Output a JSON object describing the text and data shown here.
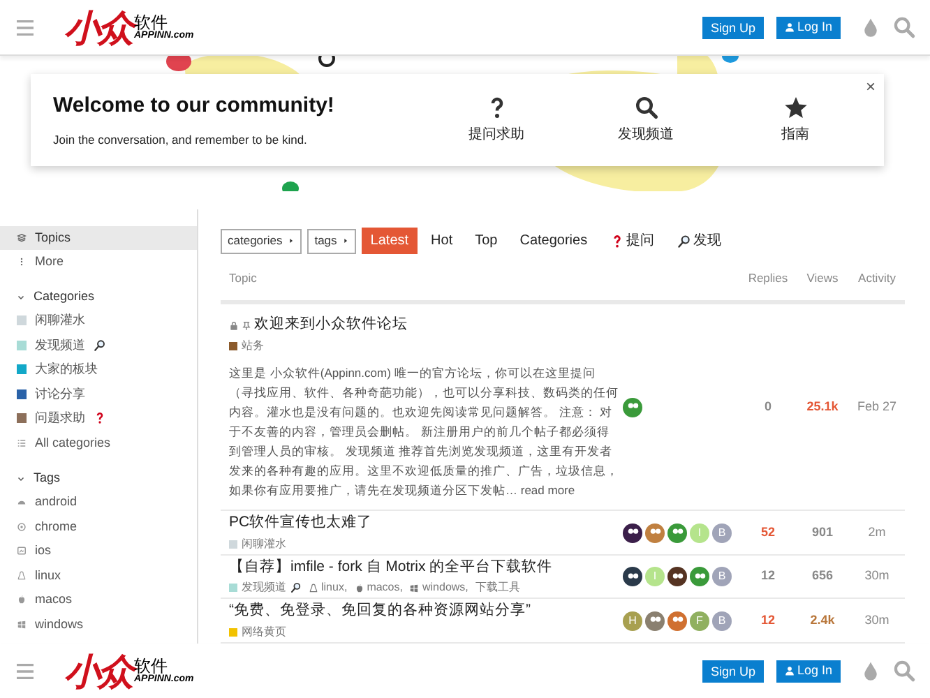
{
  "headers": [
    {
      "logo_mark": "小众",
      "logo_cn": "软件",
      "logo_en": "APPINN.com",
      "signup": "Sign Up",
      "login": "Log In"
    },
    {
      "logo_mark": "小众",
      "logo_cn": "软件",
      "logo_en": "APPINN.com",
      "signup": "Sign Up",
      "login": "Log In"
    }
  ],
  "welcome": {
    "title": "Welcome to our community!",
    "subtitle": "Join the conversation, and remember to be kind.",
    "links": [
      {
        "label": "提问求助"
      },
      {
        "label": "发现频道"
      },
      {
        "label": "指南"
      }
    ],
    "close": "×"
  },
  "sidebar": {
    "top": [
      {
        "label": "Topics",
        "selected": true
      },
      {
        "label": "More",
        "selected": false
      }
    ],
    "sections": [
      {
        "title": "Categories",
        "expanded": true,
        "items": [
          {
            "kind": "category",
            "label": "闲聊灌水",
            "color": "#cfd8dc"
          },
          {
            "kind": "category_search",
            "label": "发现频道",
            "color": "#a8dcd6"
          },
          {
            "kind": "category",
            "label": "大家的板块",
            "color": "#12a8c8"
          },
          {
            "kind": "category",
            "label": "讨论分享",
            "color": "#2a62a8"
          },
          {
            "kind": "category_question",
            "label": "问题求助",
            "color": "#8c6f5a"
          },
          {
            "kind": "all",
            "label": "All categories"
          }
        ]
      },
      {
        "title": "Tags",
        "expanded": true,
        "items": [
          {
            "kind": "android",
            "label": "android"
          },
          {
            "kind": "chrome",
            "label": "chrome"
          },
          {
            "kind": "ios",
            "label": "ios"
          },
          {
            "kind": "linux",
            "label": "linux"
          },
          {
            "kind": "macos",
            "label": "macos"
          },
          {
            "kind": "windows",
            "label": "windows"
          }
        ]
      }
    ]
  },
  "nav": {
    "dropdowns": [
      "categories",
      "tags"
    ],
    "tabs": [
      {
        "kind": "plain",
        "label": "Latest",
        "selected": true
      },
      {
        "kind": "plain",
        "label": "Hot",
        "selected": false
      },
      {
        "kind": "plain",
        "label": "Top",
        "selected": false
      },
      {
        "kind": "plain",
        "label": "Categories",
        "selected": false
      },
      {
        "kind": "question",
        "label": "提问",
        "selected": false
      },
      {
        "kind": "search",
        "label": "发现",
        "selected": false
      }
    ]
  },
  "table": {
    "columns": [
      "Topic",
      "Replies",
      "Views",
      "Activity"
    ],
    "rows": [
      {
        "title": "欢迎来到小众软件论坛",
        "locked": true,
        "pinned": true,
        "category": {
          "kind": "plain",
          "label": "站务",
          "color": "#8b5a2b"
        },
        "tags": [],
        "excerpt": "这里是 小众软件(Appinn.com) 唯一的官方论坛，你可以在这里提问（寻找应用、软件、各种奇葩功能），也可以分享科技、数码类的任何内容。灌水也是没有问题的。也欢迎先阅读常见问题解答。 注意： 对于不友善的内容，管理员会删帖。 新注册用户的前几个帖子都必须得到管理人员的审核。 发现频道 推荐首先浏览发现频道，这里有开发者发来的各种有趣的应用。这里不欢迎低质量的推广、广告，垃圾信息，如果你有应用要推广，请先在发现频道分区下发帖…",
        "read_more": "read more",
        "posters": [
          {
            "kind": "image",
            "color": "#3a9a3a"
          }
        ],
        "replies": {
          "text": "0",
          "color": "#888888"
        },
        "views": {
          "text": "25.1k",
          "color": "#e45735"
        },
        "activity": "Feb 27"
      },
      {
        "title": "PC软件宣传也太难了",
        "locked": false,
        "pinned": false,
        "category": {
          "kind": "plain",
          "label": "闲聊灌水",
          "color": "#cfd8dc"
        },
        "tags": [],
        "posters": [
          {
            "kind": "image",
            "color": "#3b1f4a"
          },
          {
            "kind": "image",
            "color": "#c08040"
          },
          {
            "kind": "image",
            "color": "#3a9a3a"
          },
          {
            "kind": "letter",
            "letter": "I",
            "color": "#b5e48c"
          },
          {
            "kind": "letter",
            "letter": "B",
            "color": "#a0a4b8"
          }
        ],
        "replies": {
          "text": "52",
          "color": "#e45735"
        },
        "views": {
          "text": "901",
          "color": "#888888"
        },
        "activity": "2m"
      },
      {
        "title": "【自荐】imfile - fork 自 Motrix 的全平台下载软件",
        "locked": false,
        "pinned": false,
        "category": {
          "kind": "search",
          "label": "发现频道",
          "color": "#a8dcd6"
        },
        "tags": [
          {
            "kind": "linux",
            "label": "linux,"
          },
          {
            "kind": "macos",
            "label": "macos,"
          },
          {
            "kind": "windows",
            "label": "windows,"
          },
          {
            "kind": "plain",
            "label": "下载工具"
          }
        ],
        "posters": [
          {
            "kind": "image",
            "color": "#2a3a4a"
          },
          {
            "kind": "letter",
            "letter": "I",
            "color": "#b5e48c"
          },
          {
            "kind": "image",
            "color": "#553322"
          },
          {
            "kind": "image",
            "color": "#3a9a3a"
          },
          {
            "kind": "letter",
            "letter": "B",
            "color": "#a0a4b8"
          }
        ],
        "replies": {
          "text": "12",
          "color": "#888888"
        },
        "views": {
          "text": "656",
          "color": "#888888"
        },
        "activity": "30m"
      },
      {
        "title": "“免费、免登录、免回复的各种资源网站分享”",
        "locked": false,
        "pinned": false,
        "category": {
          "kind": "plain",
          "label": "网络黄页",
          "color": "#f2c200"
        },
        "tags": [],
        "posters": [
          {
            "kind": "letter",
            "letter": "H",
            "color": "#a8a050"
          },
          {
            "kind": "image",
            "color": "#8a8070"
          },
          {
            "kind": "image",
            "color": "#d07030"
          },
          {
            "kind": "letter",
            "letter": "F",
            "color": "#90b060"
          },
          {
            "kind": "letter",
            "letter": "B",
            "color": "#a0a4b8"
          }
        ],
        "replies": {
          "text": "12",
          "color": "#e45735"
        },
        "views": {
          "text": "2.4k",
          "color": "#b8763a"
        },
        "activity": "30m"
      }
    ]
  }
}
